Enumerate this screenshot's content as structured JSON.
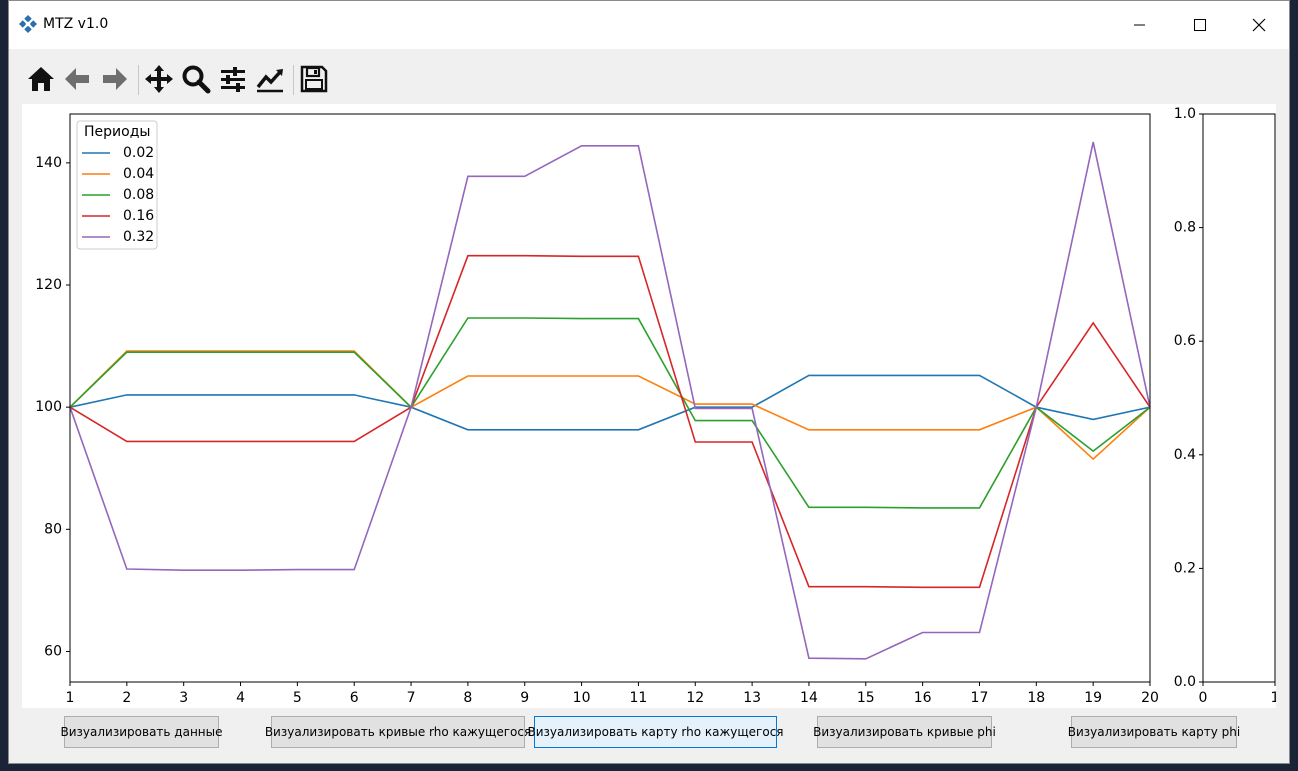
{
  "window": {
    "title": "MTZ v1.0"
  },
  "toolbar": {
    "tools": [
      {
        "name": "home-icon"
      },
      {
        "name": "back-arrow-icon"
      },
      {
        "name": "forward-arrow-icon"
      },
      {
        "name": "pan-icon"
      },
      {
        "name": "zoom-icon"
      },
      {
        "name": "subplots-config-icon"
      },
      {
        "name": "edit-axis-icon"
      },
      {
        "name": "save-icon"
      }
    ]
  },
  "buttons": {
    "visualize_data": "Визуализировать данные",
    "rho_curves": "Визуализировать кривые rho кажущегося",
    "rho_map": "Визуализировать карту rho кажущегося",
    "phi_curves": "Визуализировать кривые phi",
    "phi_map": "Визуализировать карту phi"
  },
  "chart_data": [
    {
      "type": "line",
      "legend_title": "Периоды",
      "legend_position": "upper-left",
      "x": [
        1,
        2,
        3,
        4,
        5,
        6,
        7,
        8,
        9,
        10,
        11,
        12,
        13,
        14,
        15,
        16,
        17,
        18,
        19,
        20
      ],
      "xlim": [
        1,
        20
      ],
      "ylim": [
        55,
        148
      ],
      "yticks": [
        60,
        80,
        100,
        120,
        140
      ],
      "series": [
        {
          "name": "0.02",
          "color": "#1f77b4",
          "values": [
            100,
            102,
            102,
            102,
            102,
            102,
            100,
            96.3,
            96.3,
            96.3,
            96.3,
            100,
            100,
            105.2,
            105.2,
            105.2,
            105.2,
            100,
            98,
            100
          ]
        },
        {
          "name": "0.04",
          "color": "#ff7f0e",
          "values": [
            100,
            109.2,
            109.2,
            109.2,
            109.2,
            109.2,
            100,
            105.1,
            105.1,
            105.1,
            105.1,
            100.5,
            100.5,
            96.3,
            96.3,
            96.3,
            96.3,
            100,
            91.5,
            100
          ]
        },
        {
          "name": "0.08",
          "color": "#2ca02c",
          "values": [
            100,
            109,
            109,
            109,
            109,
            109,
            100,
            114.6,
            114.6,
            114.5,
            114.5,
            97.8,
            97.8,
            83.6,
            83.6,
            83.5,
            83.5,
            100,
            92.8,
            100
          ]
        },
        {
          "name": "0.16",
          "color": "#d62728",
          "values": [
            100,
            94.4,
            94.4,
            94.4,
            94.4,
            94.4,
            100,
            124.8,
            124.8,
            124.7,
            124.7,
            94.3,
            94.3,
            70.6,
            70.6,
            70.5,
            70.5,
            100,
            113.8,
            100
          ]
        },
        {
          "name": "0.32",
          "color": "#9467bd",
          "values": [
            100,
            73.5,
            73.3,
            73.3,
            73.4,
            73.4,
            100,
            137.8,
            137.8,
            142.8,
            142.8,
            99.8,
            99.8,
            58.9,
            58.8,
            63.1,
            63.1,
            100,
            143.4,
            100
          ]
        }
      ]
    },
    {
      "type": "line",
      "xlim": [
        0,
        1
      ],
      "ylim": [
        0,
        1
      ],
      "xticks": [
        "0",
        "1"
      ],
      "yticks": [
        "0.0",
        "0.2",
        "0.4",
        "0.6",
        "0.8",
        "1.0"
      ],
      "series": []
    }
  ]
}
